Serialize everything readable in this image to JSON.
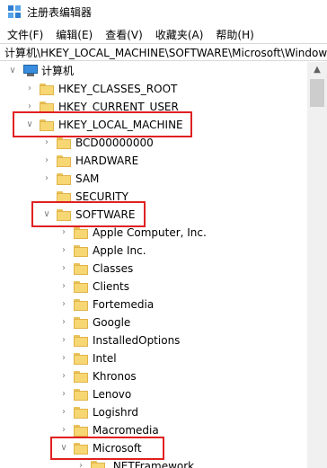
{
  "window": {
    "title": "注册表编辑器"
  },
  "menu": [
    "文件(F)",
    "编辑(E)",
    "查看(V)",
    "收藏夹(A)",
    "帮助(H)"
  ],
  "address": "计算机\\HKEY_LOCAL_MACHINE\\SOFTWARE\\Microsoft\\Windows",
  "tree": {
    "root": "计算机",
    "hives": [
      "HKEY_CLASSES_ROOT",
      "HKEY_CURRENT_USER",
      "HKEY_LOCAL_MACHINE"
    ],
    "hklm_children": [
      "BCD00000000",
      "HARDWARE",
      "SAM",
      "SECURITY",
      "SOFTWARE"
    ],
    "software_children": [
      "Apple Computer, Inc.",
      "Apple Inc.",
      "Classes",
      "Clients",
      "Fortemedia",
      "Google",
      "InstalledOptions",
      "Intel",
      "Khronos",
      "Lenovo",
      "Logishrd",
      "Macromedia",
      "Microsoft"
    ],
    "microsoft_children": [
      ".NETFramework"
    ]
  },
  "colors": {
    "highlight": "#e02020",
    "folder": "#f7d774"
  }
}
